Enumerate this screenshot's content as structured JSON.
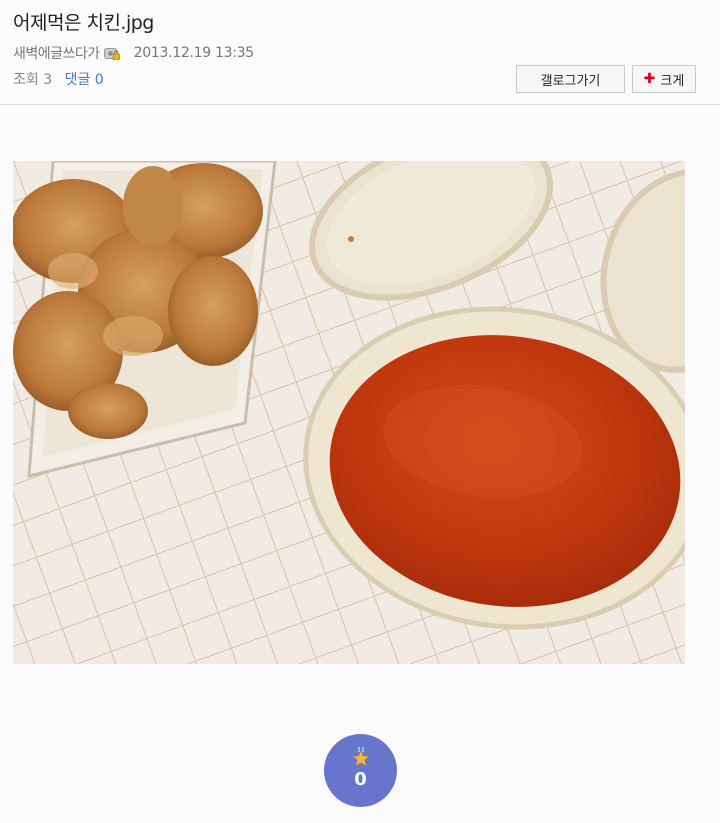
{
  "post": {
    "title": "어제먹은 치킨.jpg",
    "author": "새벽에글쓰다가",
    "date": "2013.12.19 13:35",
    "views_label": "조회 3",
    "comments_label": "댓글 0"
  },
  "buttons": {
    "gallery_label": "갤로그가기",
    "size_label": "크게"
  },
  "recommend": {
    "count": "0"
  },
  "icons": {
    "author_badge": "gallog-lock-icon",
    "enlarge": "plus-icon",
    "recommend": "star-medal-icon"
  },
  "colors": {
    "comment_link": "#4a7cc4",
    "recommend_button": "#6776cc",
    "plus_icon": "#d0021b"
  }
}
